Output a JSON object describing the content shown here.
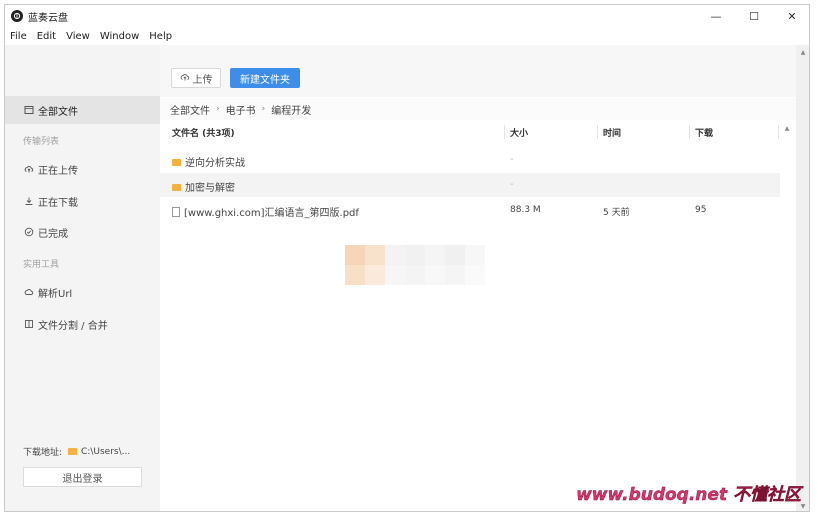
{
  "window": {
    "title": "蓝奏云盘",
    "controls": {
      "minimize": "—",
      "maximize": "☐",
      "close": "✕"
    }
  },
  "menu": [
    "File",
    "Edit",
    "View",
    "Window",
    "Help"
  ],
  "sidebar": {
    "items": [
      {
        "label": "全部文件",
        "icon": "folder-outline-icon",
        "active": true
      },
      {
        "label": "正在上传",
        "icon": "upload-cloud-icon",
        "active": false
      },
      {
        "label": "正在下载",
        "icon": "download-icon",
        "active": false
      },
      {
        "label": "已完成",
        "icon": "check-circle-icon",
        "active": false
      },
      {
        "label": "解析Url",
        "icon": "link-cloud-icon",
        "active": false
      },
      {
        "label": "文件分割 / 合并",
        "icon": "split-file-icon",
        "active": false
      }
    ],
    "sections": {
      "transfer": "传输列表",
      "tools": "实用工具"
    },
    "download_path_label": "下载地址:",
    "download_path_value": "C:\\Users\\...",
    "logout_label": "退出登录"
  },
  "toolbar": {
    "upload_label": "上传",
    "new_folder_label": "新建文件夹"
  },
  "breadcrumb": [
    "全部文件",
    "电子书",
    "编程开发"
  ],
  "table": {
    "columns": {
      "name": "文件名 (共3项)",
      "size": "大小",
      "time": "时间",
      "downloads": "下载"
    },
    "rows": [
      {
        "type": "folder",
        "name": "逆向分析实战",
        "size": "-",
        "time": "",
        "downloads": ""
      },
      {
        "type": "folder",
        "name": "加密与解密",
        "size": "-",
        "time": "",
        "downloads": ""
      },
      {
        "type": "file",
        "name": "[www.ghxi.com]汇编语言_第四版.pdf",
        "size": "88.3 M",
        "time": "5 天前",
        "downloads": "95"
      }
    ]
  },
  "colors": {
    "accent": "#3d8ee8",
    "folder": "#f5b13d",
    "sidebar_bg": "#f4f4f4",
    "watermark": "#d6336c"
  },
  "watermark": {
    "text": "www.budoq.net 不懂社区"
  }
}
